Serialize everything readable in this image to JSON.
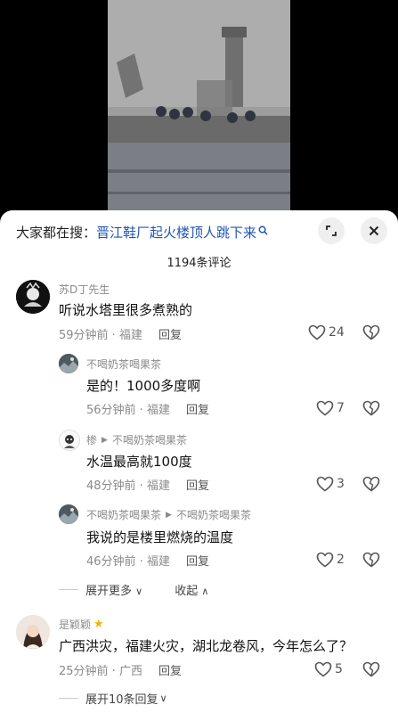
{
  "search": {
    "prefix": "大家都在搜：",
    "keyword": "晋江鞋厂起火楼顶人跳下来"
  },
  "header": {
    "comment_count": "1194条评论"
  },
  "comments": [
    {
      "username": "苏D丁先生",
      "text": "听说水塔里很多煮熟的",
      "time": "59分钟前 · 福建",
      "reply_label": "回复",
      "likes": "24"
    },
    {
      "username": "不喝奶茶喝果茶",
      "text": "是的！1000多度啊",
      "time": "56分钟前 · 福建",
      "reply_label": "回复",
      "likes": "7"
    },
    {
      "username": "椮",
      "reply_to": "不喝奶茶喝果茶",
      "text": "水温最高就100度",
      "time": "48分钟前 · 福建",
      "reply_label": "回复",
      "likes": "3"
    },
    {
      "username": "不喝奶茶喝果茶",
      "reply_to": "不喝奶茶喝果茶",
      "text": "我说的是楼里燃烧的温度",
      "time": "46分钟前 · 福建",
      "reply_label": "回复",
      "likes": "2"
    },
    {
      "username": "是颖颖",
      "text": "广西洪灾，福建火灾，湖北龙卷风，今年怎么了？",
      "time": "25分钟前 · 广西",
      "reply_label": "回复",
      "likes": "5"
    }
  ],
  "thread_controls": {
    "expand_more": "展开更多",
    "collapse": "收起",
    "expand_replies": "展开10条回复"
  },
  "icons": {
    "search": "search-icon",
    "minimize": "minimize-icon",
    "close": "close-icon",
    "like": "heart-icon",
    "dislike": "dislike-heart-icon",
    "badge": "star-icon"
  }
}
